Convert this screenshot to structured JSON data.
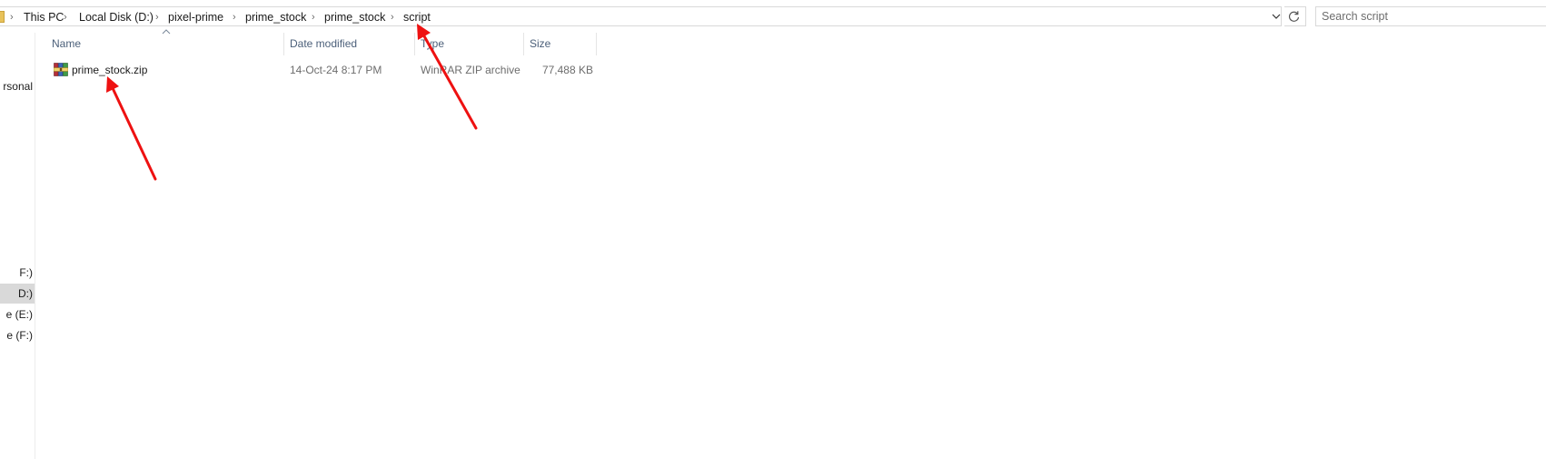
{
  "address_bar": {
    "crumbs": [
      "This PC",
      "Local Disk (D:)",
      "pixel-prime",
      "prime_stock",
      "prime_stock",
      "script"
    ]
  },
  "search": {
    "placeholder": "Search script"
  },
  "nav": {
    "items": [
      {
        "label": "rsonal"
      },
      {
        "label": "F:)"
      },
      {
        "label": "D:)"
      },
      {
        "label": "e (E:)"
      },
      {
        "label": "e (F:)"
      }
    ]
  },
  "columns": {
    "name": "Name",
    "date_modified": "Date modified",
    "type": "Type",
    "size": "Size"
  },
  "files": [
    {
      "name": "prime_stock.zip",
      "date_modified": "14-Oct-24 8:17 PM",
      "type": "WinRAR ZIP archive",
      "size": "77,488 KB",
      "icon": "winrar-archive-icon"
    }
  ],
  "colors": {
    "annotation_arrow": "#ee1111",
    "header_text": "#4c607a",
    "selected_nav": "#d9d9d9"
  }
}
